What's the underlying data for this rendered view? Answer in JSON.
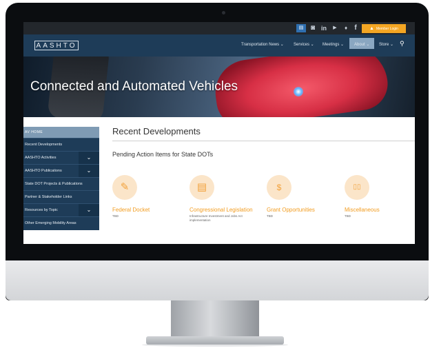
{
  "topbar": {
    "icons": [
      "newsletter-icon",
      "instagram-icon",
      "linkedin-icon",
      "youtube-icon",
      "twitter-icon",
      "facebook-icon"
    ],
    "icon_glyphs": {
      "newsletter": "▤",
      "instagram": "◙",
      "linkedin": "in",
      "youtube": "▶",
      "twitter": "♦",
      "facebook": "f"
    },
    "member_login": "Member Login"
  },
  "nav": {
    "logo": "AASHTO",
    "items": [
      "Transportation News ⌄",
      "Services ⌄",
      "Meetings ⌄",
      "About ⌄",
      "Store ⌄"
    ],
    "search_glyph": "⚲"
  },
  "hero": {
    "title": "Connected and Automated Vehicles"
  },
  "sidebar": {
    "header": "AV HOME",
    "items": [
      {
        "label": "Recent Developments"
      },
      {
        "label": "AASHTO Activities",
        "toggle": "⌄"
      },
      {
        "label": "AASHTO Publications",
        "toggle": "⌄"
      },
      {
        "label": "State DOT Projects & Publications"
      },
      {
        "label": "Partner & Stakeholder Links"
      },
      {
        "label": "Resources by Topic",
        "toggle": "⌄"
      },
      {
        "label": "Other Emerging Mobility Areas"
      }
    ]
  },
  "main": {
    "title": "Recent Developments",
    "subtitle": "Pending Action Items for State DOTs",
    "cards": [
      {
        "icon": "document-icon",
        "glyph": "✎",
        "title": "Federal Docket",
        "desc": "TBD"
      },
      {
        "icon": "legislation-icon",
        "glyph": "▤",
        "title": "Congressional Legislation",
        "desc": "Infrastructure Investment and Jobs Act implementation"
      },
      {
        "icon": "dollar-icon",
        "glyph": "$",
        "title": "Grant Opportunities",
        "desc": "TBD"
      },
      {
        "icon": "book-icon",
        "glyph": "▯▯",
        "title": "Miscellaneous",
        "desc": "TBD"
      }
    ]
  },
  "colors": {
    "navy": "#1e3c58",
    "accent": "#f29c1f",
    "member": "#f4a623"
  }
}
